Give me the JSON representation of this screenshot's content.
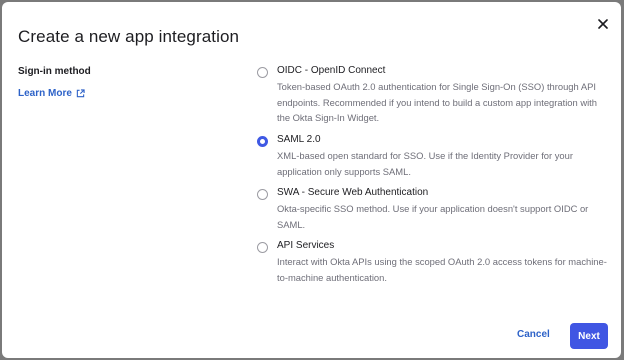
{
  "dialog": {
    "title": "Create a new app integration",
    "close_icon": "close-icon"
  },
  "left": {
    "section_label": "Sign-in method",
    "learn_more": "Learn More",
    "learn_more_icon": "external-link-icon"
  },
  "options": [
    {
      "label": "OIDC - OpenID Connect",
      "description": "Token-based OAuth 2.0 authentication for Single Sign-On (SSO) through API endpoints. Recommended if you intend to build a custom app integration with the Okta Sign-In Widget.",
      "selected": false
    },
    {
      "label": "SAML 2.0",
      "description": "XML-based open standard for SSO. Use if the Identity Provider for your application only supports SAML.",
      "selected": true
    },
    {
      "label": "SWA - Secure Web Authentication",
      "description": "Okta-specific SSO method. Use if your application doesn't support OIDC or SAML.",
      "selected": false
    },
    {
      "label": "API Services",
      "description": "Interact with Okta APIs using the scoped OAuth 2.0 access tokens for machine-to-machine authentication.",
      "selected": false
    }
  ],
  "footer": {
    "cancel_label": "Cancel",
    "next_label": "Next"
  },
  "colors": {
    "accent": "#4056e3",
    "link": "#2d62c8",
    "backdrop": "#7a7a7a"
  }
}
